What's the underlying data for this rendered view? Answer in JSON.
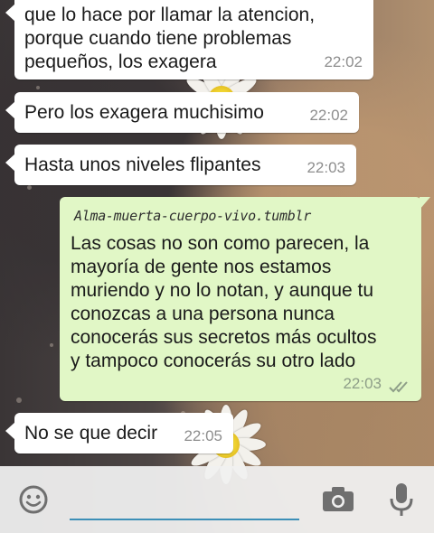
{
  "messages": [
    {
      "direction": "incoming",
      "text": "que lo hace por llamar la atencion,\nporque cuando tiene problemas\npequeños, los exagera",
      "time": "22:02"
    },
    {
      "direction": "incoming",
      "text": "Pero los exagera muchisimo",
      "time": "22:02"
    },
    {
      "direction": "incoming",
      "text": "Hasta unos niveles flipantes",
      "time": "22:03"
    },
    {
      "direction": "outgoing",
      "watermark": "Alma-muerta-cuerpo-vivo.tumblr",
      "text": "Las cosas no son como parecen, la\nmayoría de gente nos estamos\nmuriendo y no lo notan, y aunque tu\nconozcas a una persona nunca\nconocerás sus secretos más ocultos\ny tampoco conocerás su otro lado",
      "time": "22:03",
      "status": "read"
    },
    {
      "direction": "incoming",
      "text": "No se que decir",
      "time": "22:05"
    }
  ],
  "input_bar": {
    "emoji_icon": "emoji-icon",
    "camera_icon": "camera-icon",
    "mic_icon": "microphone-icon",
    "accent_color": "#3c8fb7"
  },
  "colors": {
    "incoming_bubble": "#ffffff",
    "outgoing_bubble": "#e1f7c6",
    "timestamp": "#8e8e8e"
  }
}
